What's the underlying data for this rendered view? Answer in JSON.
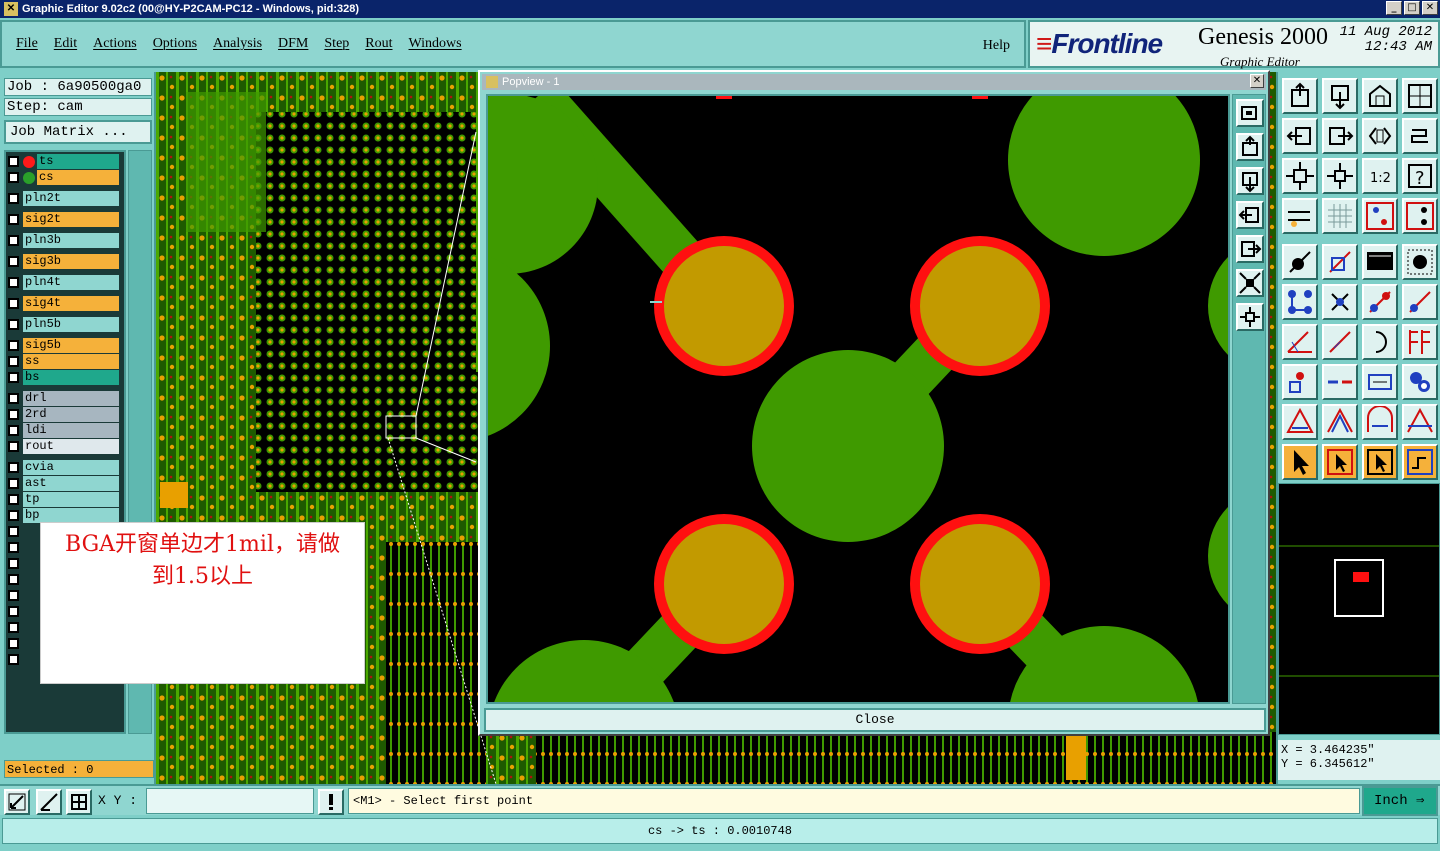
{
  "window": {
    "title": "Graphic Editor 9.02c2 (00@HY-P2CAM-PC12 - Windows, pid:328)",
    "min": "_",
    "max": "□",
    "close": "✕"
  },
  "menu": {
    "items": [
      "File",
      "Edit",
      "Actions",
      "Options",
      "Analysis",
      "DFM",
      "Step",
      "Rout",
      "Windows"
    ],
    "help": "Help"
  },
  "brand": {
    "logo_pre": "F",
    "logo_rest": "rontline",
    "product": "Genesis 2000",
    "subtitle": "Graphic Editor",
    "date": "11 Aug 2012",
    "time": "12:43 AM"
  },
  "job": {
    "job_label": "Job : 6a90500ga0",
    "step_label": "Step: cam",
    "matrix_button": "Job Matrix ..."
  },
  "layers": [
    {
      "name": "ts",
      "style": "teal",
      "dot": "#ff1a1a"
    },
    {
      "name": "cs",
      "style": "orange",
      "dot": "#2aa02a"
    },
    {
      "name": "pln2t",
      "style": "light",
      "dot": ""
    },
    {
      "name": "sig2t",
      "style": "orange",
      "dot": ""
    },
    {
      "name": "pln3b",
      "style": "light",
      "dot": ""
    },
    {
      "name": "sig3b",
      "style": "orange",
      "dot": ""
    },
    {
      "name": "pln4t",
      "style": "light",
      "dot": ""
    },
    {
      "name": "sig4t",
      "style": "orange",
      "dot": ""
    },
    {
      "name": "pln5b",
      "style": "light",
      "dot": ""
    },
    {
      "name": "sig5b",
      "style": "orange",
      "dot": ""
    },
    {
      "name": "ss",
      "style": "orange",
      "dot": ""
    },
    {
      "name": "bs",
      "style": "teal",
      "dot": ""
    },
    {
      "name": "drl",
      "style": "grey",
      "dot": ""
    },
    {
      "name": "2rd",
      "style": "grey",
      "dot": ""
    },
    {
      "name": "ldi",
      "style": "grey",
      "dot": ""
    },
    {
      "name": "rout",
      "style": "pale",
      "dot": ""
    },
    {
      "name": "cvia",
      "style": "light",
      "dot": ""
    },
    {
      "name": "ast",
      "style": "light",
      "dot": ""
    },
    {
      "name": "tp",
      "style": "light",
      "dot": ""
    },
    {
      "name": "bp",
      "style": "light",
      "dot": ""
    }
  ],
  "selected": "Selected : 0",
  "annotation": {
    "line1": "BGA开窗单边才1mil，请做",
    "line2": "到1.5以上"
  },
  "popview": {
    "title": "Popview - 1",
    "close_label": "Close",
    "close_x": "✕"
  },
  "coords": {
    "x": "X = 3.464235\"",
    "y": "Y = 6.345612\""
  },
  "bottom": {
    "xy_label": "X Y :",
    "xy_value": "",
    "prompt": "<M1> - Select first point",
    "unit": "Inch"
  },
  "status": "cs -> ts : 0.0010748",
  "colors": {
    "copper": "#3f9a00",
    "pad_open": "#c29a00",
    "mask_ring": "#ff1010",
    "background": "#7ecfc8"
  }
}
